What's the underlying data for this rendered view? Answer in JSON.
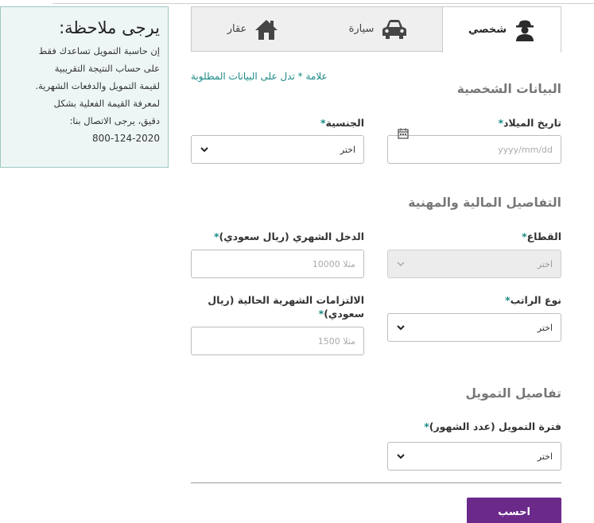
{
  "tabs": [
    {
      "label": "شخصي",
      "icon": "person-icon",
      "active": true
    },
    {
      "label": "سيارة",
      "icon": "car-icon",
      "active": false
    },
    {
      "label": "عقار",
      "icon": "house-icon",
      "active": false
    }
  ],
  "note": {
    "title": "يرجى ملاحظة:",
    "lines": [
      "إن حاسبة التمويل تساعدك فقط",
      "على حساب النتيجة التقريبية",
      "لقيمة التمويل والدفعات الشهرية.",
      "لمعرفة القيمة الفعلية بشكل",
      "دقيق، يرجى الاتصال بنا:"
    ],
    "phone": "800-124-2020"
  },
  "required_note": {
    "text": "علامة * تدل على البيانات المطلوبة"
  },
  "sections": {
    "personal": "البيانات الشخصية",
    "financial": "التفاصيل المالية والمهنية",
    "financing": "تفاصيل التمويل"
  },
  "fields": {
    "birth_date": {
      "label": "تاريخ الميلاد",
      "placeholder": "yyyy/mm/dd"
    },
    "nationality": {
      "label": "الجنسية",
      "value": "اختر"
    },
    "sector": {
      "label": "القطاع",
      "value": "اختر"
    },
    "monthly_income": {
      "label": "الدخل الشهري (ريال سعودي)",
      "placeholder": "مثلا 10000"
    },
    "salary_type": {
      "label": "نوع الراتب",
      "value": "اختر"
    },
    "obligations": {
      "label_line1": "الالتزامات الشهرية الحالية (ريال",
      "label_line2": "سعودي)",
      "placeholder": "مثلا 1500"
    },
    "financing_period": {
      "label": "فترة التمويل (عدد الشهور)",
      "value": "اختر"
    }
  },
  "submit": {
    "label": "احسب"
  },
  "colors": {
    "accent": "#1b8a86",
    "button": "#6b2a8a",
    "note_bg": "#eef6f5"
  }
}
